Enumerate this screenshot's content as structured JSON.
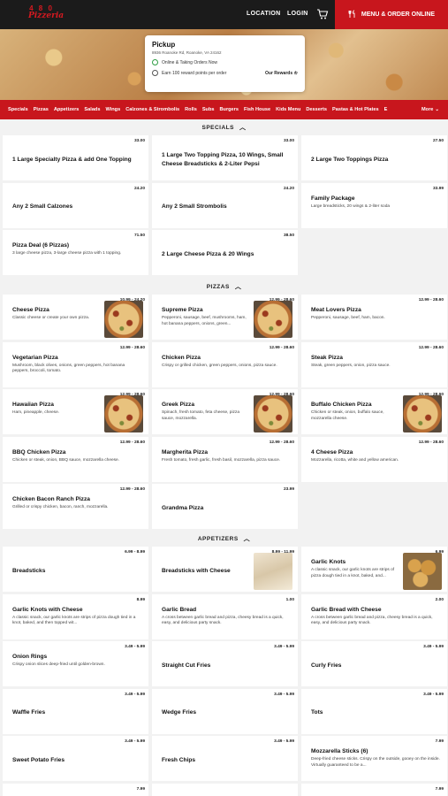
{
  "header": {
    "logo_top": "4 8 0",
    "logo_bottom": "Pizzeria",
    "location": "LOCATION",
    "login": "LOGIN",
    "order_button": "MENU & ORDER ONLINE"
  },
  "store": {
    "title": "Pickup",
    "address": "8936 Roanoke Rd, Roanoke, VA 24162",
    "status": "Online & Taking Orders Now",
    "reward_points": "Earn 100 reward points per order",
    "our_rewards": "Our Rewards"
  },
  "categories": [
    "Specials",
    "Pizzas",
    "Appetizers",
    "Salads",
    "Wings",
    "Calzones & Strombolis",
    "Rolls",
    "Subs",
    "Burgers",
    "Fish House",
    "Kids Menu",
    "Desserts",
    "Pastas & Hot Plates",
    "E"
  ],
  "more_label": "More",
  "sections": {
    "specials": "SPECIALS",
    "pizzas": "PIZZAS",
    "appetizers": "APPETIZERS"
  },
  "specials": [
    {
      "name": "1 Large Specialty Pizza & add One Topping",
      "price": "33.00",
      "desc": ""
    },
    {
      "name": "1 Large Two Topping Pizza, 10 Wings, Small Cheese Breadsticks & 2-Liter Pepsi",
      "price": "33.00",
      "desc": ""
    },
    {
      "name": "2 Large Two Toppings Pizza",
      "price": "27.50",
      "desc": ""
    },
    {
      "name": "Any 2 Small Calzones",
      "price": "24.20",
      "desc": ""
    },
    {
      "name": "Any 2 Small Strombolis",
      "price": "24.20",
      "desc": ""
    },
    {
      "name": "Family Package",
      "price": "33.99",
      "desc": "Large breadsticks, 20 wings & 2-liter soda"
    },
    {
      "name": "Pizza Deal (6 Pizzas)",
      "price": "71.50",
      "desc": "3 large cheese pizza, 3-large cheese pizza with 1 topping."
    },
    {
      "name": "2 Large Cheese Pizza & 20 Wings",
      "price": "38.50",
      "desc": ""
    }
  ],
  "pizzas": [
    {
      "name": "Cheese Pizza",
      "price": "10.99 - 24.20",
      "desc": "Classic cheese or create your own pizza."
    },
    {
      "name": "Supreme Pizza",
      "price": "12.99 - 28.60",
      "desc": "Pepperoni, sausage, beef, mushrooms, ham, hot banana peppers, onions, green..."
    },
    {
      "name": "Meat Lovers Pizza",
      "price": "12.99 - 28.60",
      "desc": "Pepperoni, sausage, beef, ham, bacon."
    },
    {
      "name": "Vegetarian Pizza",
      "price": "12.99 - 28.60",
      "desc": "Mushroom, black olives, onions, green peppers, hot banana peppers, broccoli, tomato."
    },
    {
      "name": "Chicken Pizza",
      "price": "12.99 - 28.60",
      "desc": "Crispy or grilled chicken, green peppers, onions, pizza sauce."
    },
    {
      "name": "Steak Pizza",
      "price": "12.99 - 28.60",
      "desc": "Steak, green peppers, onion, pizza sauce."
    },
    {
      "name": "Hawaiian Pizza",
      "price": "12.99 - 28.60",
      "desc": "Ham, pineapple, cheese."
    },
    {
      "name": "Greek Pizza",
      "price": "12.99 - 28.60",
      "desc": "Spinach, fresh tomato, feta cheese, pizza sauce, mozzarella."
    },
    {
      "name": "Buffalo Chicken Pizza",
      "price": "12.99 - 28.60",
      "desc": "Chicken or steak, onion, buffalo sauce, mozzarella cheese."
    },
    {
      "name": "BBQ Chicken Pizza",
      "price": "12.99 - 28.60",
      "desc": "Chicken or steak, onion, BBQ sauce, mozzarella cheese."
    },
    {
      "name": "Margherita Pizza",
      "price": "12.99 - 28.60",
      "desc": "Fresh tomato, fresh garlic, fresh basil, mozzarella, pizza sauce."
    },
    {
      "name": "4 Cheese Pizza",
      "price": "12.99 - 28.60",
      "desc": "Mozzarella, ricotta, white and yellow american."
    },
    {
      "name": "Chicken Bacon Ranch Pizza",
      "price": "12.99 - 28.60",
      "desc": "Grilled or crispy chicken, bacon, ranch, mozzarella."
    },
    {
      "name": "Grandma Pizza",
      "price": "23.99",
      "desc": ""
    }
  ],
  "appetizers": [
    {
      "name": "Breadsticks",
      "price": "6.99 - 8.99",
      "desc": ""
    },
    {
      "name": "Breadsticks with Cheese",
      "price": "8.99 - 11.99",
      "desc": ""
    },
    {
      "name": "Garlic Knots",
      "price": "6.99",
      "desc": "A classic snack, our garlic knots are strips of pizza dough tied in a knot, baked, and..."
    },
    {
      "name": "Garlic Knots with Cheese",
      "price": "8.99",
      "desc": "A classic snack, our garlic knots are strips of pizza dough tied in a knot, baked, and then topped wit..."
    },
    {
      "name": "Garlic Bread",
      "price": "1.00",
      "desc": "A cross between garlic bread and pizza, cheesy bread is a quick, easy, and delicious party snack."
    },
    {
      "name": "Garlic Bread with Cheese",
      "price": "2.00",
      "desc": "A cross between garlic bread and pizza, cheesy bread is a quick, easy, and delicious party snack."
    },
    {
      "name": "Onion Rings",
      "price": "3.49 - 5.99",
      "desc": "Crispy onion slices deep-fried until golden-brown."
    },
    {
      "name": "Straight Cut Fries",
      "price": "3.49 - 5.99",
      "desc": ""
    },
    {
      "name": "Curly Fries",
      "price": "3.49 - 5.99",
      "desc": ""
    },
    {
      "name": "Waffle Fries",
      "price": "3.49 - 5.99",
      "desc": ""
    },
    {
      "name": "Wedge Fries",
      "price": "3.49 - 5.99",
      "desc": ""
    },
    {
      "name": "Tots",
      "price": "3.49 - 5.99",
      "desc": ""
    },
    {
      "name": "Sweet Potato Fries",
      "price": "3.49 - 5.99",
      "desc": ""
    },
    {
      "name": "Fresh Chips",
      "price": "3.49 - 5.99",
      "desc": ""
    },
    {
      "name": "Mozzarella Sticks (6)",
      "price": "7.99",
      "desc": "Deep-fried cheese sticks. Crispy on the outside, gooey on the inside. Virtually guaranteed to be a..."
    },
    {
      "name": "",
      "price": "7.99",
      "desc": ""
    },
    {
      "name": "",
      "price": "",
      "desc": ""
    },
    {
      "name": "",
      "price": "7.99",
      "desc": ""
    }
  ]
}
